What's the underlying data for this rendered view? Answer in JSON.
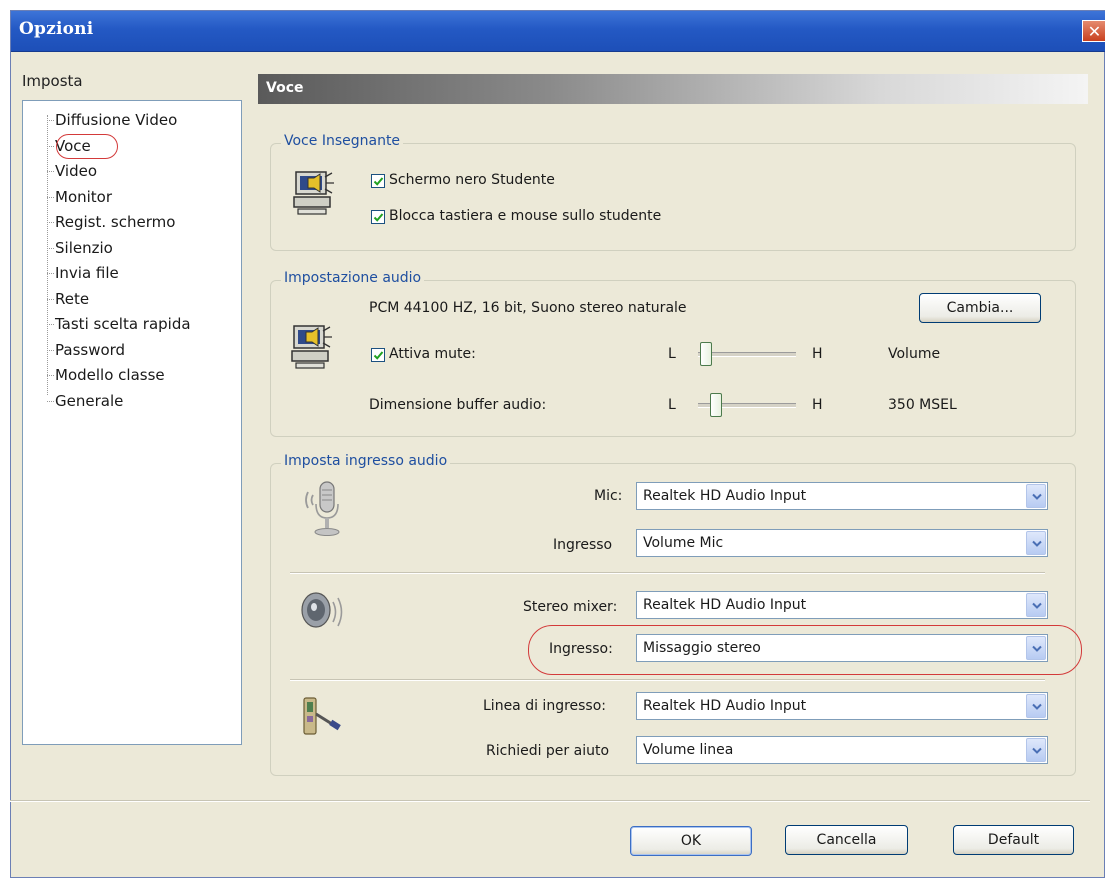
{
  "window": {
    "title": "Opzioni",
    "close_glyph": "✕"
  },
  "sidebar": {
    "label": "Imposta",
    "items": [
      {
        "label": "Diffusione Video"
      },
      {
        "label": "Voce",
        "selected": true
      },
      {
        "label": "Video"
      },
      {
        "label": "Monitor"
      },
      {
        "label": "Regist. schermo"
      },
      {
        "label": "Silenzio"
      },
      {
        "label": "Invia file"
      },
      {
        "label": "Rete"
      },
      {
        "label": "Tasti scelta rapida"
      },
      {
        "label": "Password"
      },
      {
        "label": "Modello classe"
      },
      {
        "label": "Generale"
      }
    ]
  },
  "panel": {
    "title": "Voce"
  },
  "voce_insegnante": {
    "title": "Voce Insegnante",
    "checkbox1": {
      "label": "Schermo nero Studente",
      "checked": true
    },
    "checkbox2": {
      "label": "Blocca tastiera e mouse sullo studente",
      "checked": true
    }
  },
  "audio": {
    "title": "Impostazione audio",
    "format": "PCM 44100 HZ, 16 bit, Suono stereo naturale",
    "change_button": "Cambia...",
    "mute": {
      "label": "Attiva mute:",
      "checked": true,
      "low": "L",
      "high": "H",
      "value": "Volume"
    },
    "buffer": {
      "label": "Dimensione buffer audio:",
      "low": "L",
      "high": "H",
      "value": "350 MSEL"
    }
  },
  "input": {
    "title": "Imposta ingresso audio",
    "mic_label": "Mic:",
    "mic_value": "Realtek HD Audio Input",
    "mic_input_label": "Ingresso",
    "mic_input_value": "Volume Mic",
    "stereo_label": "Stereo mixer:",
    "stereo_value": "Realtek HD Audio Input",
    "stereo_input_label": "Ingresso:",
    "stereo_input_value": "Missaggio stereo",
    "line_label": "Linea di ingresso:",
    "line_value": "Realtek HD Audio Input",
    "help_label": "Richiedi per aiuto",
    "help_value": "Volume linea"
  },
  "footer": {
    "ok": "OK",
    "cancel": "Cancella",
    "default": "Default"
  },
  "colors": {
    "title_bar": "#2459c4",
    "group_title": "#1f4fa0",
    "highlight": "#d33a3a",
    "background": "#ece9d8"
  },
  "icons": {
    "teacher_voice": "teacher-computer-speaker-icon",
    "audio_settings": "computer-speaker-icon",
    "mic": "microphone-icon",
    "stereo": "speaker-icon",
    "line": "line-in-jack-icon"
  }
}
